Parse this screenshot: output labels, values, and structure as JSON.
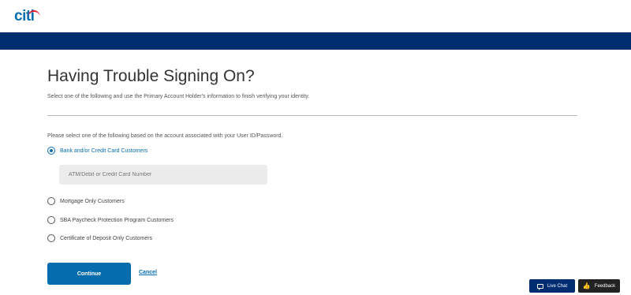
{
  "brand": {
    "logo_text": "citi",
    "accent_color": "#056dae",
    "arc_color": "#e31837",
    "band_color": "#002d72"
  },
  "page": {
    "title": "Having Trouble Signing On?",
    "subtitle": "Select one of the following and use the Primary Account Holder's information to finish verifying your identity.",
    "prompt": "Please select one of the following based on the account associated with your User ID/Password."
  },
  "options": [
    {
      "label": "Bank and/or Credit Card Customers",
      "selected": true
    },
    {
      "label": "Mortgage Only Customers",
      "selected": false
    },
    {
      "label": "SBA Paycheck Protection Program Customers",
      "selected": false
    },
    {
      "label": "Certificate of Deposit Only Customers",
      "selected": false
    }
  ],
  "card_field": {
    "placeholder": "ATM/Debit or Credit Card Number",
    "value": ""
  },
  "actions": {
    "continue_label": "Continue",
    "cancel_label": "Cancel"
  },
  "widgets": {
    "live_chat_label": "Live Chat",
    "feedback_label": "Feedback",
    "live_chat_icon": "chat-icon",
    "feedback_icon": "thumbs-up-icon"
  }
}
